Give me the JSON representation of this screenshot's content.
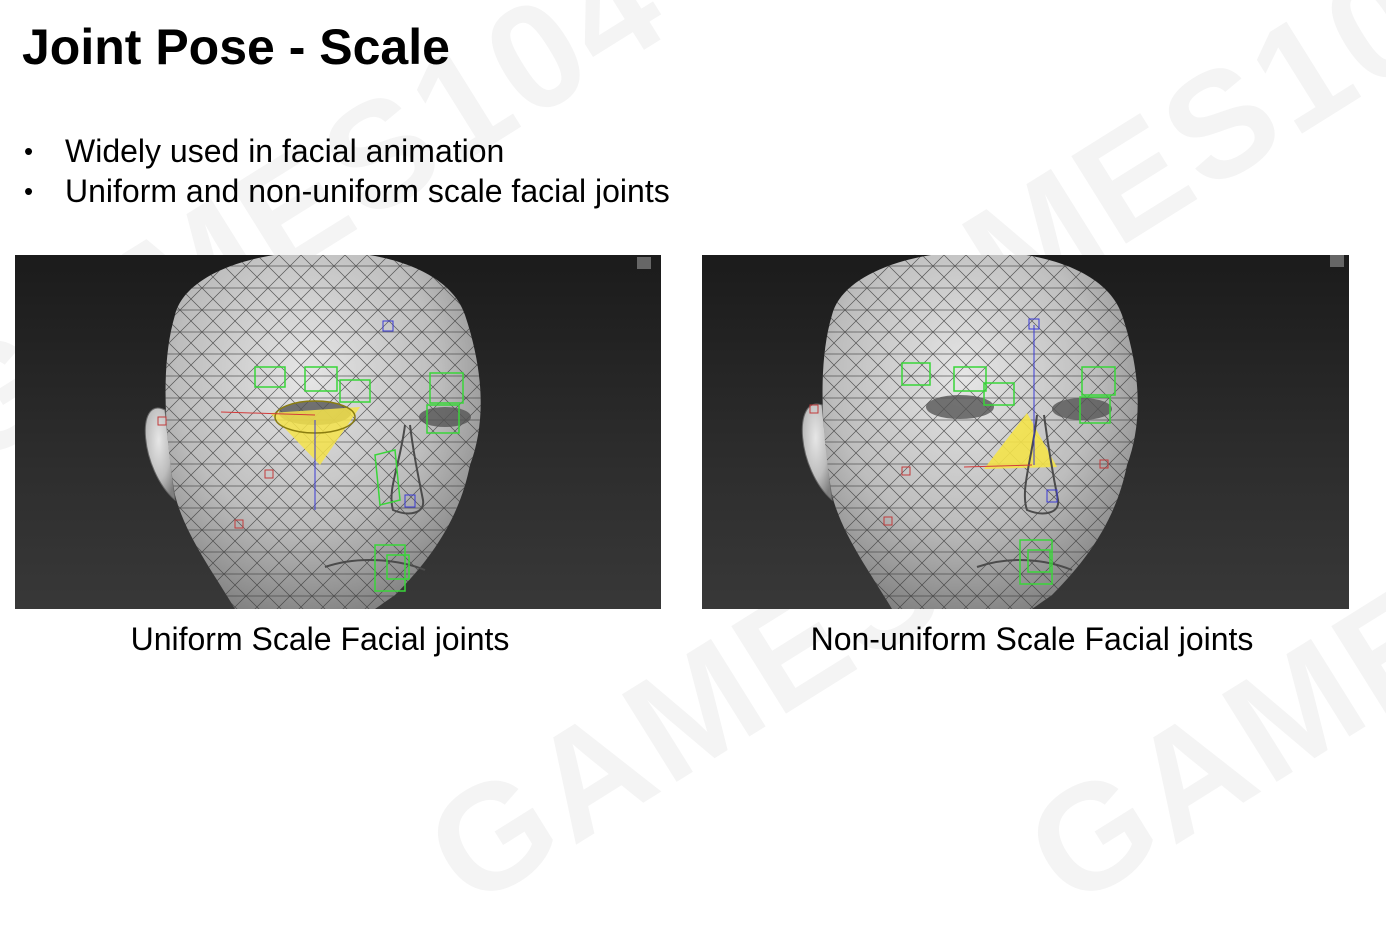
{
  "slide": {
    "title": "Joint Pose - Scale",
    "bullets": [
      "Widely used in facial animation",
      "Uniform and non-uniform scale facial joints"
    ],
    "watermark": "GAMES104"
  },
  "figures": [
    {
      "caption": "Uniform Scale Facial joints",
      "highlight_color": "#f4e34a"
    },
    {
      "caption": "Non-uniform Scale Facial joints",
      "highlight_color": "#f4e34a"
    }
  ],
  "colors": {
    "joint_box": "#39d639",
    "joint_marker": "#c23a3a",
    "axis_blue": "#3a3ad6"
  }
}
